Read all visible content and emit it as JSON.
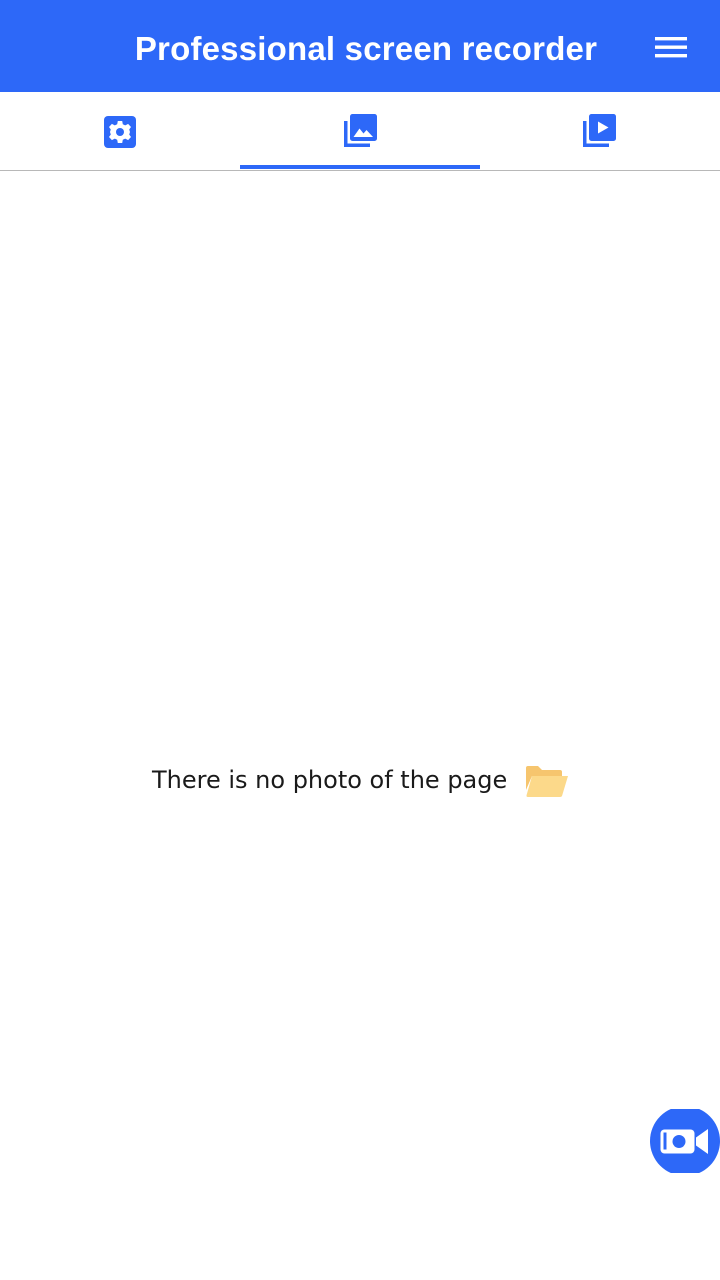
{
  "app_bar": {
    "title": "Professional screen recorder",
    "background_color": "#2d68f8",
    "menu_icon": "hamburger-menu-icon"
  },
  "tabs": [
    {
      "id": "settings",
      "icon": "gear-icon",
      "selected": false
    },
    {
      "id": "photos",
      "icon": "photo-library-icon",
      "selected": true
    },
    {
      "id": "videos",
      "icon": "video-library-icon",
      "selected": false
    }
  ],
  "accent_color": "#2d68f8",
  "empty_state": {
    "message": "There is no photo of the page",
    "icon": "open-folder-icon",
    "icon_color": "#fcd98a"
  },
  "fab": {
    "icon": "video-camera-icon"
  }
}
